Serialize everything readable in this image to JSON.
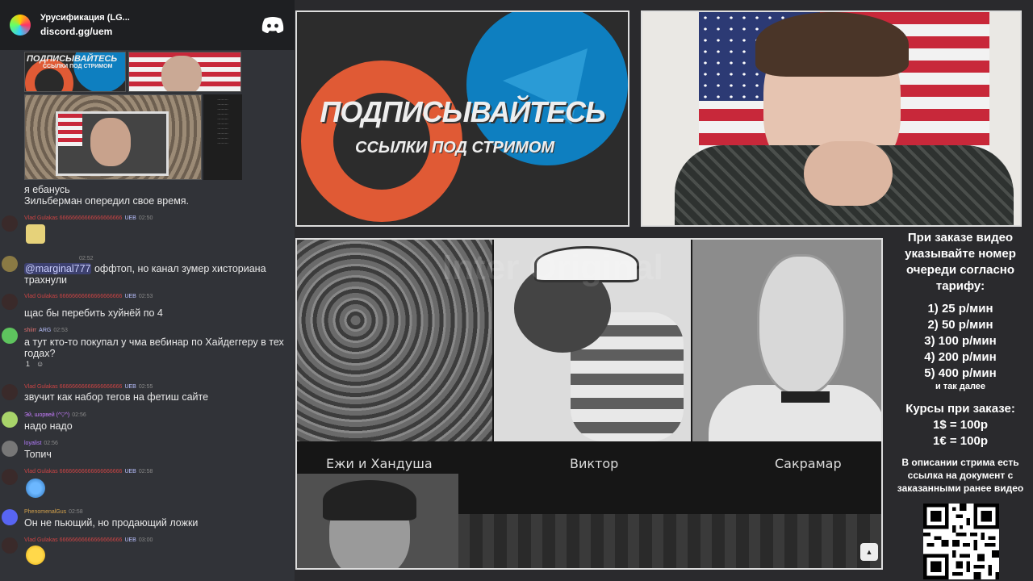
{
  "header": {
    "server_name": "Урусификация (LG...",
    "invite": "discord.gg/uem"
  },
  "chat": {
    "top_attachment_text": [
      "ПОДПИСЫВАЙТЕСЬ",
      "ССЫЛКИ ПОД СТРИМОМ"
    ],
    "text_lines": [
      "я ебанусь",
      "Зильберман опередил свое время."
    ],
    "messages": [
      {
        "author": "Vlad Gulakas 66666666666666666666",
        "badge": "UEB",
        "time": "02:50",
        "text": ""
      },
      {
        "author": "",
        "badge": "",
        "time": "02:52",
        "mention": "@marginal777",
        "text": " оффтоп, но канал зумер хисториана трахнули"
      },
      {
        "author": "Vlad Gulakas 66666666666666666666",
        "badge": "UEB",
        "time": "02:53",
        "text": "щас бы перебить хуйнёй по 4"
      },
      {
        "author": "shiirr",
        "badge": "ARG",
        "time": "02:53",
        "text": "а тут кто-то покупал у чма вебинар по Хайдеггеру в тех годах?",
        "reaction": "1"
      },
      {
        "author": "Vlad Gulakas 66666666666666666666",
        "badge": "UEB",
        "time": "02:55",
        "text": "звучит как набор тегов на фетиш сайте"
      },
      {
        "author": "Эй, шорвей (^▽^)",
        "badge": "",
        "time": "02:56",
        "text": "надо надо"
      },
      {
        "author": "loyalist",
        "badge": "",
        "time": "02:56",
        "text": "Топич"
      },
      {
        "author": "Vlad Gulakas 66666666666666666666",
        "badge": "UEB",
        "time": "02:58",
        "text": ""
      },
      {
        "author": "PhenomenalGus",
        "badge": "",
        "time": "02:58",
        "text": "Он не пьющий, но продающий ложки"
      },
      {
        "author": "Vlad Gulakas 66666666666666666666",
        "badge": "UEB",
        "time": "03:00",
        "text": ""
      }
    ]
  },
  "promo": {
    "title": "ПОДПИСЫВАЙТЕСЬ",
    "subtitle": "ССЫЛКИ ПОД СТРИМОМ"
  },
  "video": {
    "watermark": "Inter Original",
    "captions": [
      "Ежи и Хандуша",
      "Виктор",
      "Сакрамар"
    ]
  },
  "info": {
    "heading": "При заказе видео указывайте номер очереди согласно тарифу:",
    "prices": [
      "1) 25 р/мин",
      "2) 50 р/мин",
      "3) 100 р/мин",
      "4) 200 р/мин",
      "5) 400 р/мин"
    ],
    "etc": "и так далее",
    "rates_title": "Курсы при заказе:",
    "rates": [
      "1$ = 100р",
      "1€ = 100р"
    ],
    "description": "В описании стрима есть ссылка на документ с заказанными ранее видео"
  },
  "colors": {
    "discord_bg": "#313338",
    "header_bg": "#1e1f22",
    "promo_blue": "#0e7fc0",
    "promo_orange": "#e05a35"
  }
}
